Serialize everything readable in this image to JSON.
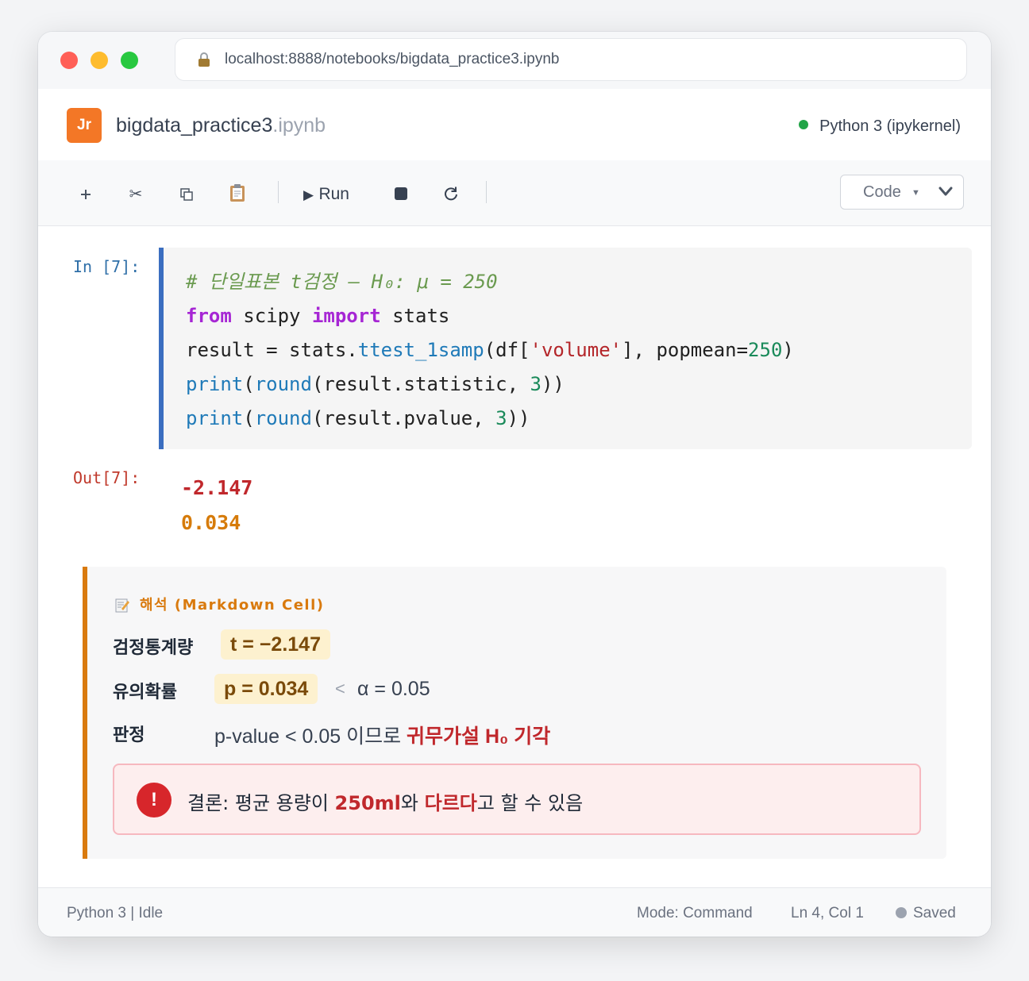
{
  "window": {
    "url": "localhost:8888/notebooks/bigdata_practice3.ipynb"
  },
  "header": {
    "logo": "Jr",
    "notebook_name": "bigdata_practice3",
    "notebook_ext": ".ipynb",
    "kernel": "Python 3 (ipykernel)",
    "kernel_status_color": "#22a447"
  },
  "toolbar": {
    "add_icon": "plus-icon",
    "cut_icon": "scissors-icon",
    "copy_icon": "copy-icon",
    "paste_icon": "clipboard-icon",
    "run_label": "Run",
    "stop_icon": "stop-icon",
    "restart_icon": "restart-icon",
    "cell_type": "Code"
  },
  "code_cell": {
    "prompt": "In [7]:",
    "lines": [
      "# 단일표본 t검정 — H₀: μ = 250",
      "from scipy import stats",
      "result = stats.ttest_1samp(df['volume'], popmean=250)",
      "print(round(result.statistic, 3))",
      "print(round(result.pvalue, 3))"
    ]
  },
  "output": {
    "prompt": "Out[7]:",
    "line1": "-2.147",
    "line2": "0.034"
  },
  "markdown": {
    "title": "해석 (Markdown Cell)",
    "stat_label": "검정통계량",
    "stat_value": "t = −2.147",
    "p_label": "유의확률",
    "p_value": "p = 0.034",
    "p_compare": "<",
    "alpha": "α = 0.05",
    "decision_label": "판정",
    "decision_plain": "p-value < 0.05 이므로 ",
    "decision_strong": "귀무가설 H₀ 기각",
    "conclusion_icon": "!",
    "conclusion_prefix": "결론: 평균 용량이 ",
    "conclusion_strong1": "250ml",
    "conclusion_mid": "와 ",
    "conclusion_strong2": "다르다",
    "conclusion_suffix": "고 할 수 있음"
  },
  "statusbar": {
    "left": "Python 3 | Idle",
    "mode": "Mode: Command",
    "position": "Ln 4, Col 1",
    "saved": "Saved"
  }
}
